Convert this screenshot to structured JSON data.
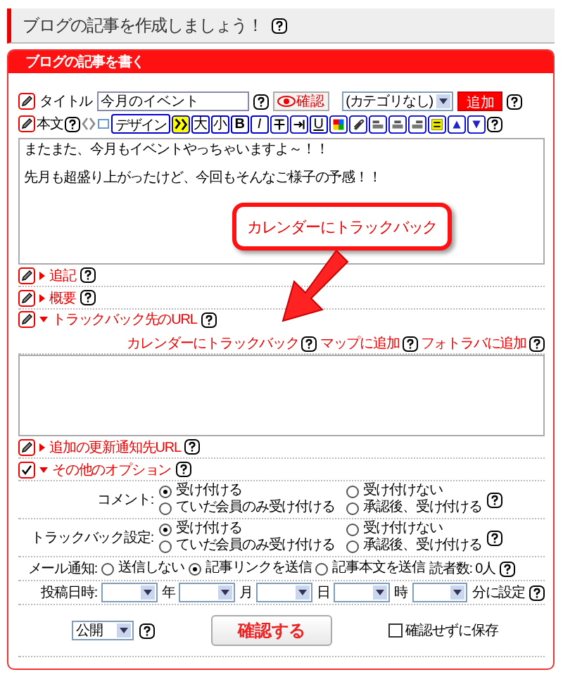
{
  "page_title": "ブログの記事を作成しましょう！",
  "panel_title": "ブログの記事を書く",
  "title_row": {
    "label": "タイトル",
    "value": "今月のイベント",
    "preview_button": "確認",
    "category": "(カテゴリなし)",
    "add_button": "追加"
  },
  "body_row": {
    "label": "本文",
    "design_button": "デザイン",
    "tools": [
      {
        "kind": "emoji"
      },
      {
        "kind": "text",
        "label": "大"
      },
      {
        "kind": "text",
        "label": "小"
      },
      {
        "kind": "bold",
        "label": "B"
      },
      {
        "kind": "italic",
        "label": "I"
      },
      {
        "kind": "strike"
      },
      {
        "kind": "indent"
      },
      {
        "kind": "underline",
        "label": "U"
      },
      {
        "kind": "color"
      },
      {
        "kind": "link"
      },
      {
        "kind": "align-left"
      },
      {
        "kind": "align-center"
      },
      {
        "kind": "align-right"
      },
      {
        "kind": "face"
      },
      {
        "kind": "up"
      },
      {
        "kind": "down"
      }
    ]
  },
  "body_lines": [
    "またまた、今月もイベントやっちゃいますよ～！！",
    "先月も超盛り上がったけど、今回もそんなご様子の予感！！"
  ],
  "callout": "カレンダーにトラックバック",
  "addendum": {
    "label": "追記",
    "expanded": false
  },
  "summary": {
    "label": "概要",
    "expanded": false
  },
  "trackback": {
    "label": "トラックバック先のURL",
    "expanded": true,
    "links": [
      "カレンダーにトラックバック",
      "マップに追加",
      "フォトラバに追加"
    ]
  },
  "update_urls": {
    "label": "追加の更新通知先URL",
    "expanded": false
  },
  "other_options": {
    "label": "その他のオプション",
    "expanded": true
  },
  "comment": {
    "label": "コメント:",
    "options": [
      {
        "label": "受け付ける",
        "selected": true
      },
      {
        "label": "受け付けない",
        "selected": false
      },
      {
        "label": "ていだ会員のみ受け付ける",
        "selected": false
      },
      {
        "label": "承認後、受け付ける",
        "selected": false
      }
    ]
  },
  "trackback_setting": {
    "label": "トラックバック設定:",
    "options": [
      {
        "label": "受け付ける",
        "selected": true
      },
      {
        "label": "受け付けない",
        "selected": false
      },
      {
        "label": "ていだ会員のみ受け付ける",
        "selected": false
      },
      {
        "label": "承認後、受け付ける",
        "selected": false
      }
    ]
  },
  "mail": {
    "label": "メール通知:",
    "options": [
      {
        "label": "送信しない",
        "selected": false
      },
      {
        "label": "記事リンクを送信",
        "selected": true
      },
      {
        "label": "記事本文を送信",
        "selected": false
      }
    ],
    "readers": "読者数: 0人"
  },
  "post_date": {
    "label": "投稿日時:",
    "units": [
      "年",
      "月",
      "日",
      "時",
      "分に設定"
    ]
  },
  "footer": {
    "status": "公開",
    "submit": "確認する",
    "no_confirm": {
      "label": "確認せずに保存",
      "checked": false
    }
  }
}
